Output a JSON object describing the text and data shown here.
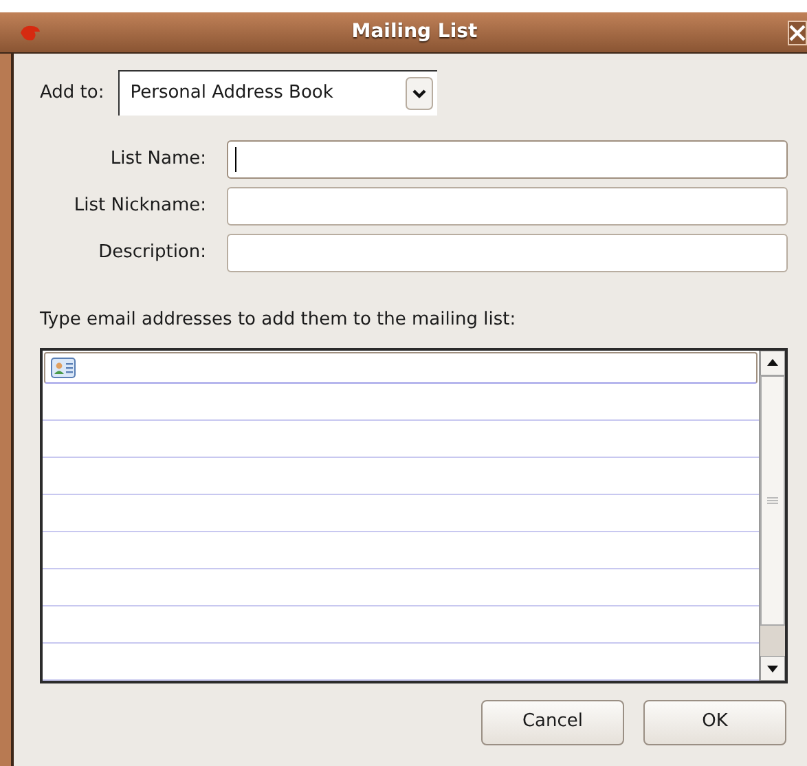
{
  "window": {
    "title": "Mailing List"
  },
  "add_to": {
    "label": "Add to:",
    "value": "Personal Address Book"
  },
  "fields": [
    {
      "label": "List Name:",
      "focused": true
    },
    {
      "label": "List Nickname:",
      "focused": false
    },
    {
      "label": "Description:",
      "focused": false
    }
  ],
  "addresses": {
    "label": "Type email addresses to add them to the mailing list:"
  },
  "buttons": [
    {
      "label": "Cancel"
    },
    {
      "label": "OK"
    }
  ]
}
